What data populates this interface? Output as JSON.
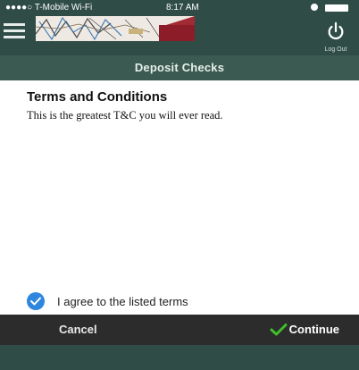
{
  "status_bar": {
    "carrier": "●●●●○ T-Mobile Wi-Fi",
    "time": "8:17 AM"
  },
  "header": {
    "logout_label": "Log Out"
  },
  "title_bar": {
    "title": "Deposit Checks"
  },
  "terms": {
    "heading": "Terms and Conditions",
    "body": "This is the greatest T&C you will ever read."
  },
  "agreement": {
    "label": "I agree to the listed terms",
    "checked": true
  },
  "actions": {
    "cancel_label": "Cancel",
    "continue_label": "Continue"
  },
  "colors": {
    "header_bg": "#2f4d46",
    "title_bar_bg": "#3b5a52",
    "action_bar_bg": "#2c2c2c",
    "check_blue": "#2f86de",
    "continue_check_green": "#3fbf2a"
  },
  "icons": {
    "menu": "hamburger-menu-icon",
    "logout": "power-icon",
    "check": "check-icon",
    "continue": "checkmark-icon"
  }
}
